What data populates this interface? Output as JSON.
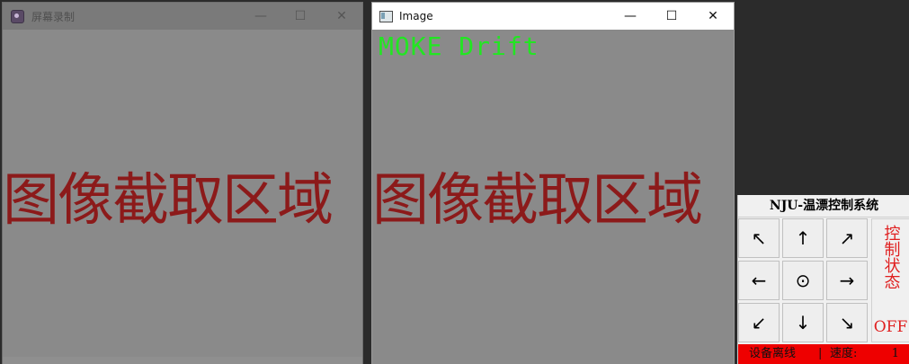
{
  "window_recorder": {
    "title": "屏幕录制",
    "region_text": "图像截取区域",
    "icon": "app-icon"
  },
  "window_image": {
    "title": "Image",
    "overlay_text": "MOKE Drift",
    "region_text": "图像截取区域",
    "icon": "image-window-icon"
  },
  "window_controls": {
    "minimize": "—",
    "maximize": "☐",
    "close": "✕"
  },
  "panel": {
    "title": "NJU-温漂控制系统",
    "buttons": {
      "up_left": "↖",
      "up": "↑",
      "up_right": "↗",
      "left": "←",
      "center": "⊙",
      "right": "→",
      "down_left": "↙",
      "down": "↓",
      "down_right": "↘"
    },
    "control_status_label": "控制状态",
    "control_status_value": "OFF",
    "device_status": "设备离线",
    "separator": "|",
    "speed_label": "速度:",
    "speed_value": "1"
  },
  "colors": {
    "region_text": "#8c1a1a",
    "overlay_text": "#22e622",
    "status_red": "#e02020",
    "status_bar": "#ee0000"
  }
}
